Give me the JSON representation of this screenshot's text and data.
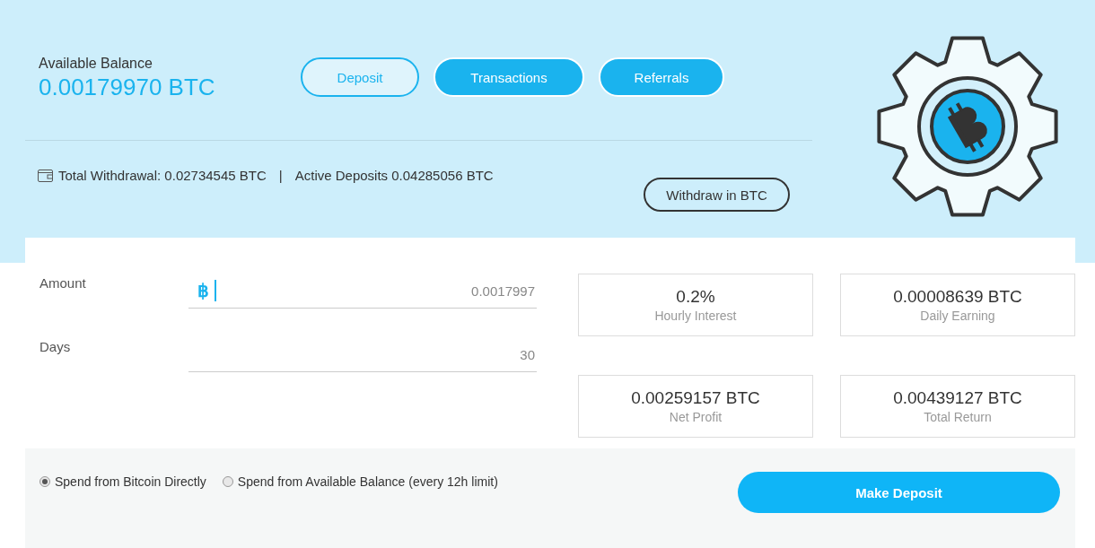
{
  "balance": {
    "label": "Available Balance",
    "value": "0.00179970 BTC"
  },
  "nav_buttons": [
    {
      "label": "Deposit",
      "selected": true
    },
    {
      "label": "Transactions",
      "selected": false
    },
    {
      "label": "Referrals",
      "selected": false
    }
  ],
  "summary": {
    "total_withdrawal": "Total Withdrawal: 0.02734545 BTC",
    "separator": "|",
    "active_deposits": "Active Deposits 0.04285056 BTC"
  },
  "withdraw_button": "Withdraw in BTC",
  "form": {
    "amount": {
      "label": "Amount",
      "currency_symbol": "฿",
      "value": "0.0017997"
    },
    "days": {
      "label": "Days",
      "value": "30"
    }
  },
  "stats": [
    {
      "value": "0.2%",
      "label": "Hourly Interest"
    },
    {
      "value": "0.00008639 BTC",
      "label": "Daily Earning"
    },
    {
      "value": "0.00259157 BTC",
      "label": "Net Profit"
    },
    {
      "value": "0.00439127 BTC",
      "label": "Total Return"
    }
  ],
  "payment_options": [
    {
      "label": "Spend from Bitcoin Directly",
      "selected": true
    },
    {
      "label": "Spend from Available Balance (every 12h limit)",
      "selected": false
    }
  ],
  "submit_button": "Make Deposit"
}
